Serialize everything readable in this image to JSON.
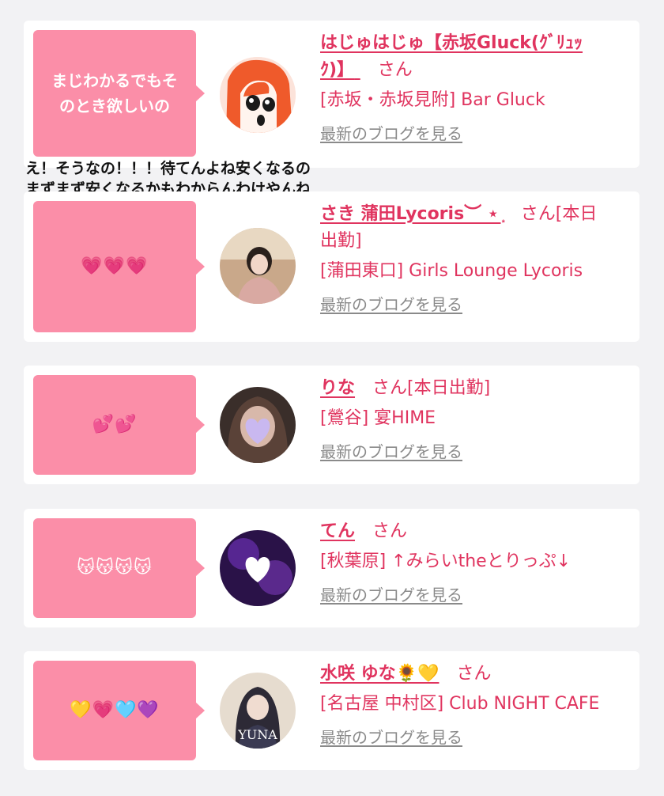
{
  "overlay": {
    "line1": "え！そうなの！！！待てんよね安くなるの",
    "line2": "まずまず安くなるかもわからんわけやんね"
  },
  "cards": [
    {
      "message": "まじわかるでもそのとき欲しいの",
      "message_line1": "まじわかるでもそ",
      "message_line2": "のとき欲しいの",
      "name": "はじゅはじゅ【赤坂Gluck(ｸﾞﾘｭｯｸ)】",
      "name_line1": "はじゅはじゅ【赤坂Gluck(ｸﾞﾘｭｯ",
      "name_line2": "ｸ)】",
      "honorific": "さん",
      "status": "",
      "shop": "[赤坂・赤坂見附] Bar Gluck",
      "blog_link": "最新のブログを見る"
    },
    {
      "message": "💗💗💗",
      "name": "さき 蒲田Lycoris︶ ⋆ ͙",
      "honorific": "さん",
      "status": "[本日出勤]",
      "status_line1": "[本日",
      "status_line2": "出勤]",
      "shop": "[蒲田東口] Girls Lounge Lycoris",
      "blog_link": "最新のブログを見る"
    },
    {
      "message": "💕💕",
      "name": "りな",
      "honorific": "さん",
      "status": "[本日出勤]",
      "shop": "[鶯谷] 宴HIME",
      "blog_link": "最新のブログを見る"
    },
    {
      "message": "😽😽😽😽",
      "name": "てん",
      "honorific": "さん",
      "status": "",
      "shop": "[秋葉原] ↑みらいtheとりっぷ↓",
      "blog_link": "最新のブログを見る"
    },
    {
      "message": "💛💗🩵💜",
      "name": "水咲 ゆな🌻💛",
      "honorific": "さん",
      "status": "",
      "shop": "[名古屋 中村区] Club NIGHT CAFE",
      "blog_link": "最新のブログを見る",
      "avatar_caption": "YUNA"
    }
  ],
  "colors": {
    "background": "#f2f2f4",
    "bubble": "#fb8ea8",
    "accent": "#e0345f",
    "link_gray": "#8a8a8a"
  }
}
